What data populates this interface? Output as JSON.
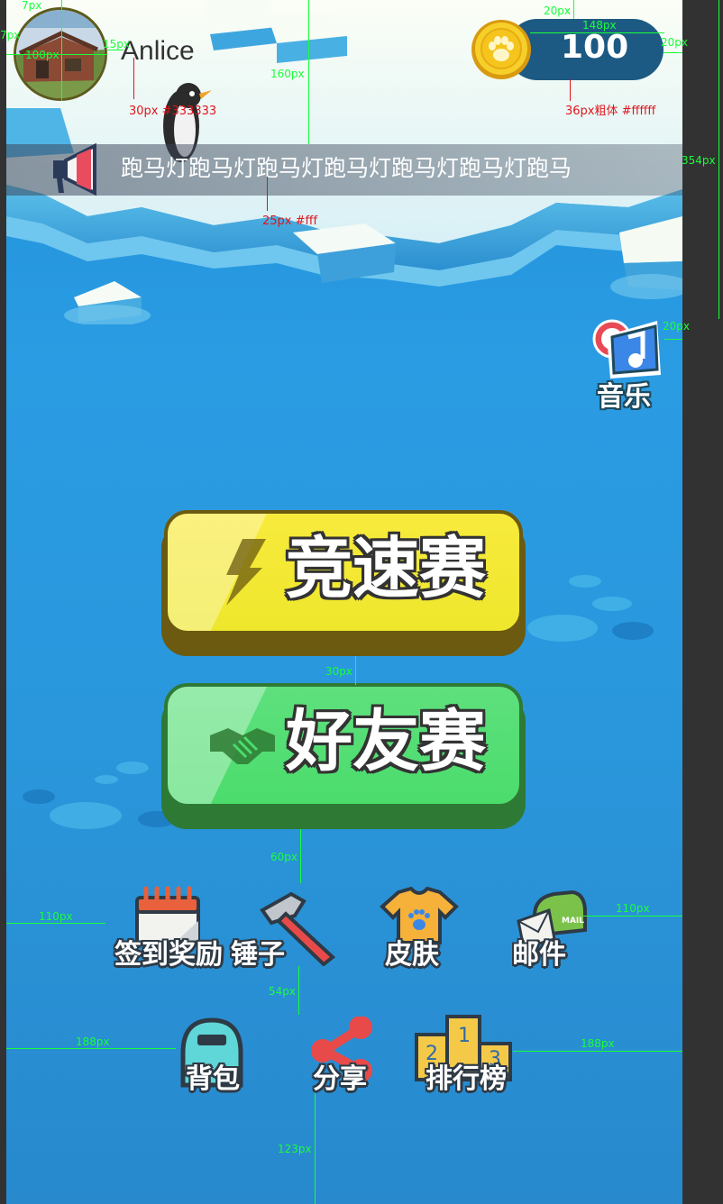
{
  "user": {
    "name": "Anlice"
  },
  "coins": {
    "value": "100"
  },
  "marquee": {
    "text": "跑马灯跑马灯跑马灯跑马灯跑马灯跑马灯跑马"
  },
  "music": {
    "label": "音乐"
  },
  "buttons": {
    "speed_race": {
      "label": "竞速赛",
      "color": "#f2e632"
    },
    "friend_race": {
      "label": "好友赛",
      "color": "#4fdc74"
    }
  },
  "menu_row1": [
    {
      "label": "签到奖励",
      "icon": "calendar-icon"
    },
    {
      "label": "锤子",
      "icon": "hammer-icon"
    },
    {
      "label": "皮肤",
      "icon": "tshirt-icon"
    },
    {
      "label": "邮件",
      "icon": "mailbox-icon"
    }
  ],
  "menu_row2": [
    {
      "label": "背包",
      "icon": "backpack-icon"
    },
    {
      "label": "分享",
      "icon": "share-icon"
    },
    {
      "label": "排行榜",
      "icon": "podium-icon"
    }
  ],
  "podium_numbers": [
    "1",
    "2",
    "3"
  ],
  "annotations": {
    "green": [
      "7px",
      "7px",
      "100px",
      "15px",
      "20px",
      "148px",
      "20px",
      "160px",
      "354px",
      "20px",
      "30px",
      "60px",
      "110px",
      "110px",
      "54px",
      "188px",
      "188px",
      "123px"
    ],
    "red": [
      "30px #333333",
      "36px粗体 #ffffff",
      "25px #fff"
    ]
  },
  "colors": {
    "coin_pill": "#1d5a83",
    "coin_gold": "#f5c51d",
    "sea": "#2a97dc",
    "ice": "#eaf6fb"
  }
}
